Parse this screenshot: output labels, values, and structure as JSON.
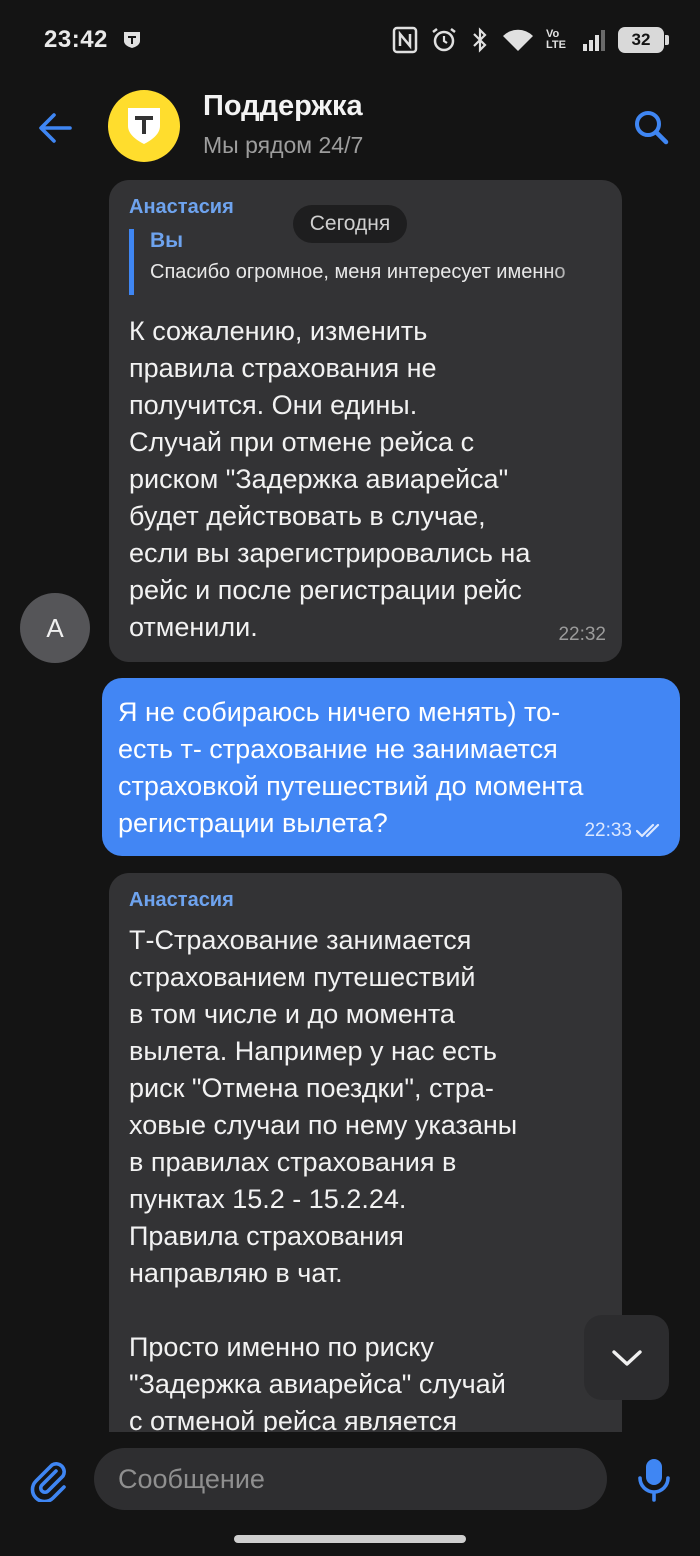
{
  "status_bar": {
    "time": "23:42",
    "network_label": "Vo LTE",
    "battery": "32"
  },
  "header": {
    "title": "Поддержка",
    "subtitle": "Мы рядом 24/7",
    "logo_letter": "Т"
  },
  "date_separator": "Сегодня",
  "messages": [
    {
      "direction": "incoming",
      "sender": "Анастасия",
      "reply": {
        "name": "Вы",
        "text": "Спасибо огромное, меня интересует именно"
      },
      "text": "К сожалению, изменить\nправила страхования не\nполучится. Они едины.\nСлучай при отмене рейса с\nриском \"Задержка авиарейса\"\nбудет действовать в случае,\nесли вы зарегистрировались на\nрейс и после регистрации рейс\nотменили.",
      "time": "22:32",
      "avatar_letter": "А"
    },
    {
      "direction": "outgoing",
      "text": "Я не собираюсь ничего менять) то-\nесть т- страхование не занимается\nстраховкой путешествий до момента\nрегистрации вылета?",
      "time": "22:33",
      "status": "read"
    },
    {
      "direction": "incoming",
      "sender": "Анастасия",
      "text": "Т-Страхование занимается\nстрахованием путешествий\nв том числе и до момента\nвылета. Например у нас есть\nриск \"Отмена поездки\", стра-\nховые случаи по нему указаны\nв правилах страхования в\nпунктах 15.2 - 15.2.24.\nПравила страхования\nнаправляю в чат.\n\nПросто именно по риску\n\"Задержка авиарейса\" случай\nс отменой рейса является"
    }
  ],
  "input": {
    "placeholder": "Сообщение"
  },
  "colors": {
    "background": "#141414",
    "incoming_bubble": "#333335",
    "outgoing_bubble": "#4286f4",
    "accent": "#3f86f3",
    "logo_yellow": "#ffdd2d"
  }
}
